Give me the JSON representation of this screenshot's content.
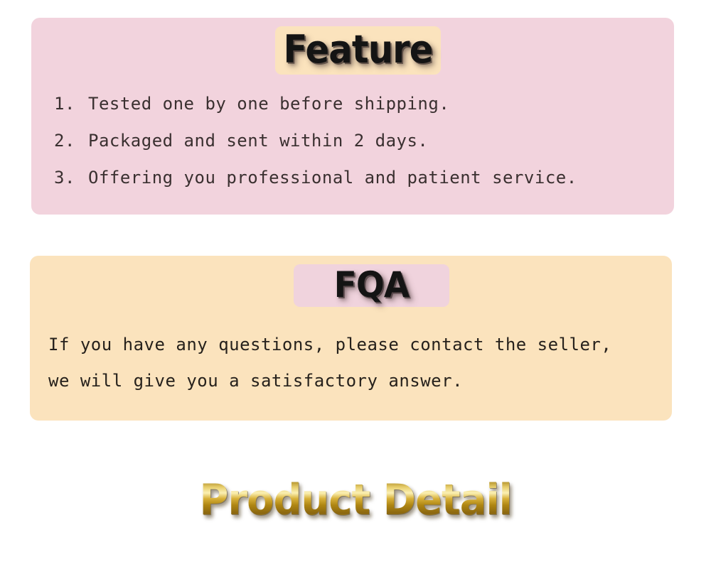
{
  "feature_section": {
    "badge_label": "Feature",
    "badge_bg_color": "#fbe3bd",
    "panel_bg_color": "#f2d3dd",
    "items": [
      {
        "number": "1.",
        "text": "Tested one by one before shipping."
      },
      {
        "number": "2.",
        "text": "Packaged and sent within 2 days."
      },
      {
        "number": "3.",
        "text": "Offering you professional and patient service."
      }
    ]
  },
  "fqa_section": {
    "badge_label": "FQA",
    "badge_bg_color": "#f0d3dd",
    "panel_bg_color": "#fbe3bd",
    "lines": [
      "If you have any questions, please contact the seller,",
      "we will give you a satisfactory answer."
    ]
  },
  "product_detail_heading": {
    "text": "Product Detail",
    "gold_dark_color": "#8a6610",
    "gold_light_color": "#fbf0b4"
  }
}
